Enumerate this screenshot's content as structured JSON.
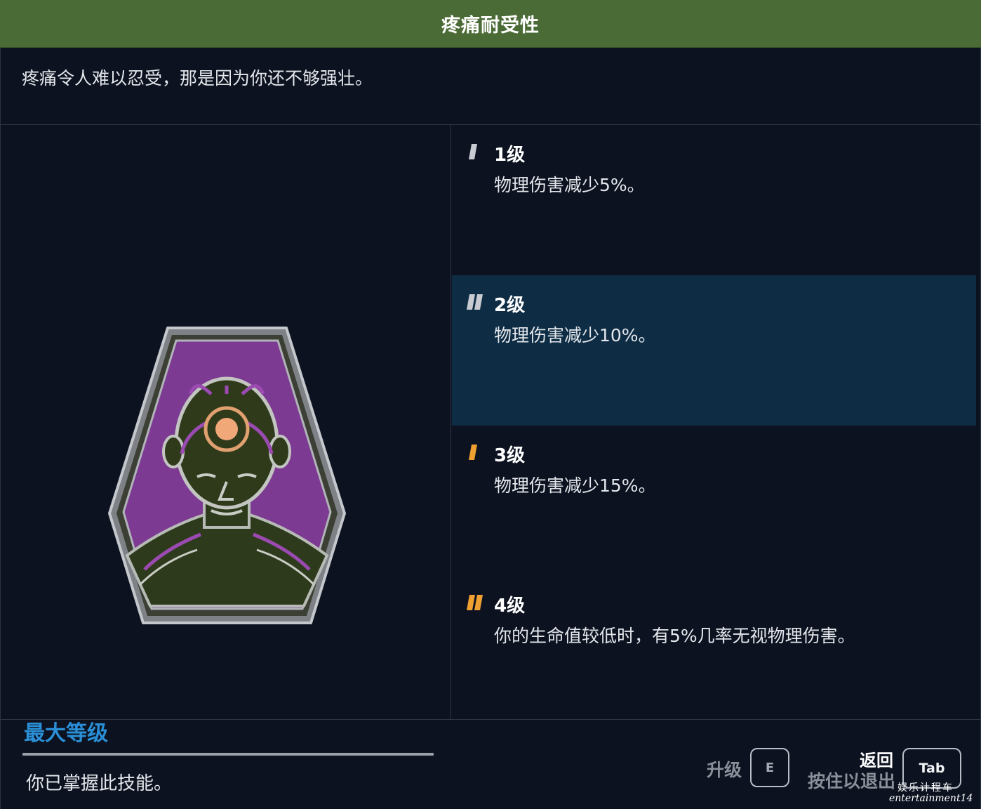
{
  "header": {
    "title": "疼痛耐受性"
  },
  "skill": {
    "description": "疼痛令人难以忍受，那是因为你还不够强壮。"
  },
  "badge": {
    "icon": "head-with-glowing-forehead-emblem"
  },
  "status": {
    "label": "最大等级",
    "text": "你已掌握此技能。"
  },
  "levels": [
    {
      "name": "1级",
      "desc": "物理伤害减少5%。",
      "marks": 1,
      "mark_color": "#c8ccd2",
      "active": false
    },
    {
      "name": "2级",
      "desc": "物理伤害减少10%。",
      "marks": 2,
      "mark_color": "#c8ccd2",
      "active": true
    },
    {
      "name": "3级",
      "desc": "物理伤害减少15%。",
      "marks": 1,
      "mark_color": "#f0a030",
      "active": false
    },
    {
      "name": "4级",
      "desc": "你的生命值较低时，有5%几率无视物理伤害。",
      "marks": 2,
      "mark_color": "#f0a030",
      "active": false
    }
  ],
  "footer": {
    "upgrade_label": "升级",
    "upgrade_key": "E",
    "back_label": "返回",
    "hold_exit_label": "按住以退出",
    "back_key": "Tab"
  },
  "watermark": {
    "line1": "娱乐计程车",
    "line2": "entertainment14"
  },
  "colors": {
    "title_bar": "#4b6b36",
    "max_level": "#2a8fd6",
    "active_row": "#0e2d45",
    "background": "#0c1220"
  }
}
